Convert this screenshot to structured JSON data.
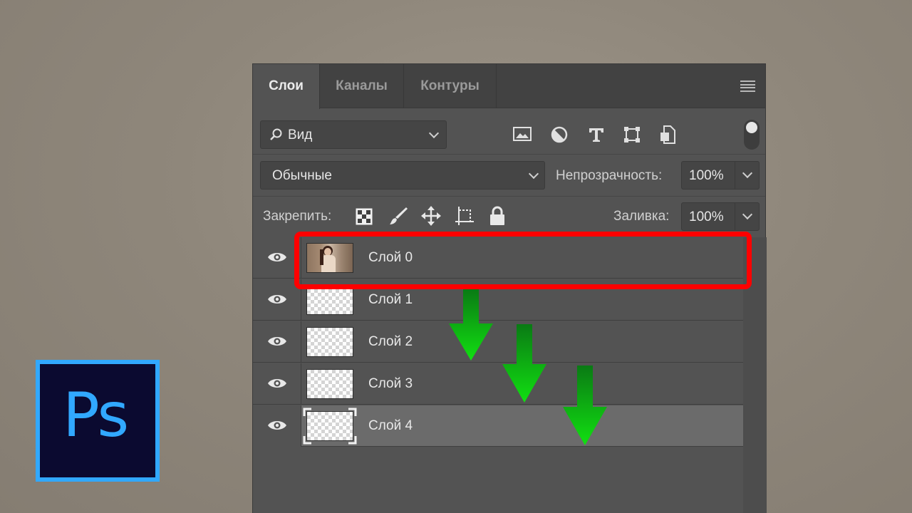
{
  "panel": {
    "tabs": [
      {
        "label": "Слои",
        "active": true
      },
      {
        "label": "Каналы",
        "active": false
      },
      {
        "label": "Контуры",
        "active": false
      }
    ],
    "filter": {
      "value": "Вид",
      "icons": [
        "image-filter-icon",
        "adjustment-filter-icon",
        "type-filter-icon",
        "shape-filter-icon",
        "smart-object-filter-icon"
      ]
    },
    "blend_mode": "Обычные",
    "opacity_label": "Непрозрачность:",
    "opacity_value": "100%",
    "lock_label": "Закрепить:",
    "lock_icons": [
      "lock-transparent-icon",
      "lock-image-icon",
      "lock-position-icon",
      "lock-artboard-icon",
      "lock-all-icon"
    ],
    "fill_label": "Заливка:",
    "fill_value": "100%",
    "layers": [
      {
        "name": "Слой 0",
        "thumbnail": "photo",
        "selected": false
      },
      {
        "name": "Слой 1",
        "thumbnail": "transparent",
        "selected": false
      },
      {
        "name": "Слой 2",
        "thumbnail": "transparent",
        "selected": false
      },
      {
        "name": "Слой 3",
        "thumbnail": "transparent",
        "selected": false
      },
      {
        "name": "Слой 4",
        "thumbnail": "transparent",
        "selected": true
      }
    ]
  },
  "annotations": {
    "highlight_color": "#ff0000",
    "arrow_color": "#00dd00",
    "arrow_count": 3
  },
  "logo": {
    "text": "Ps",
    "accent": "#31a8ff",
    "background": "#0b0a30"
  }
}
